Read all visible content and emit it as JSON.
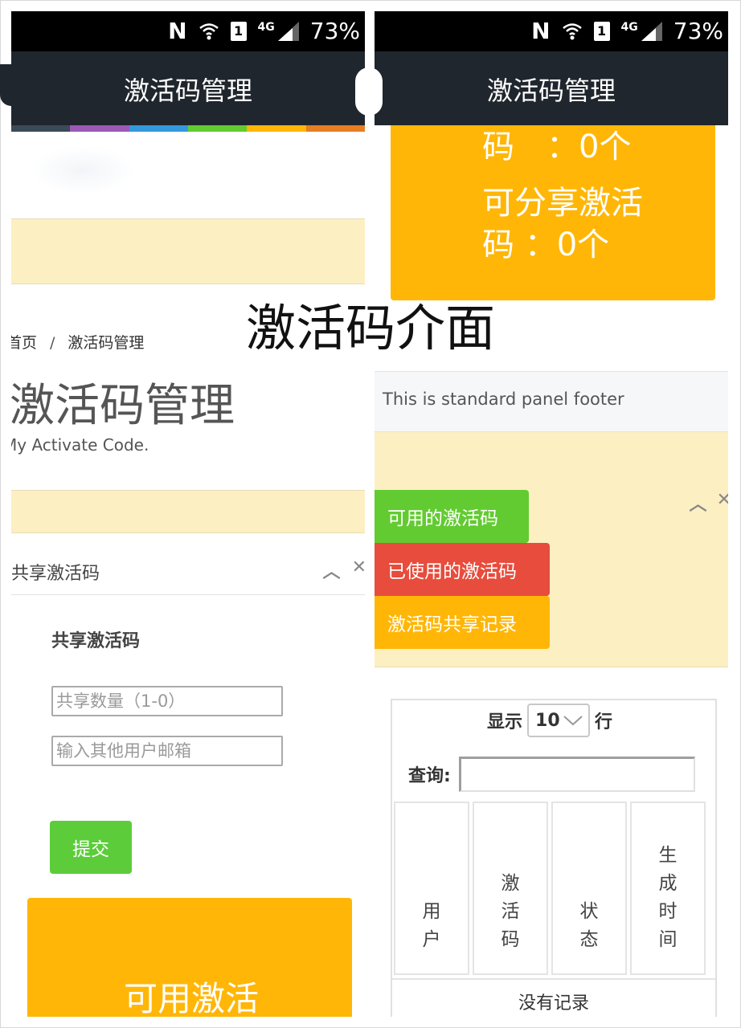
{
  "status_bar": {
    "nfc": "N",
    "sim": "1",
    "network": "4G",
    "battery": "73%"
  },
  "left": {
    "nav_title": "激活码管理",
    "color_strip": [
      "#3b4a57",
      "#9b59b6",
      "#3498db",
      "#62cb31",
      "#ffb606",
      "#e67e22"
    ],
    "breadcrumb": {
      "home": "首页",
      "sep": "/",
      "current": "激活码管理"
    },
    "page_title": "激活码管理",
    "page_subtitle": "My Activate Code.",
    "box_title": "共享激活码",
    "form": {
      "title": "共享激活码",
      "quantity_placeholder": "共享数量（1-0）",
      "email_placeholder": "输入其他用户邮箱",
      "submit_label": "提交"
    },
    "stat_box_text": "可用激活"
  },
  "right": {
    "nav_title": "激活码管理",
    "stat_lines": [
      "码　：0个",
      "可分享激活",
      "码 ：0个"
    ],
    "panel_footer": "This is standard panel footer",
    "code_buttons": [
      {
        "label": "可用的激活码",
        "color": "#62cb31"
      },
      {
        "label": "已使用的激活码",
        "color": "#e74c3c"
      },
      {
        "label": "激活码共享记录",
        "color": "#ffb606"
      }
    ],
    "table": {
      "show_label": "显示",
      "page_length": "10",
      "rows_label": "行",
      "search_label": "查询:",
      "columns": [
        "用户",
        "激活码",
        "状态",
        "生成时间"
      ],
      "empty_text": "没有记录"
    }
  },
  "overlay_caption": "激活码介面"
}
